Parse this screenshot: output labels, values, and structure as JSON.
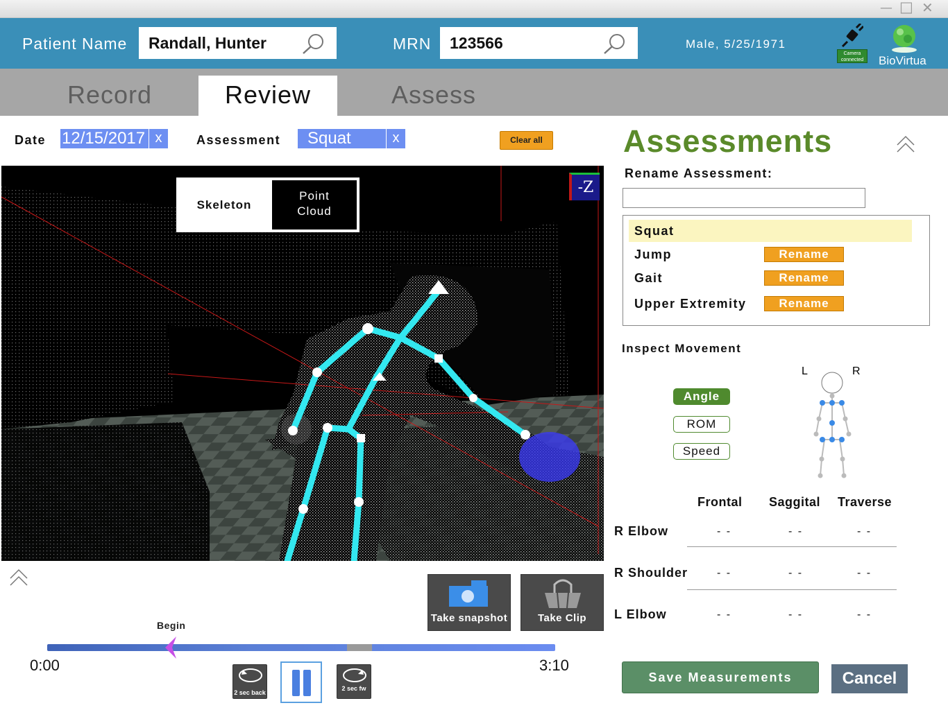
{
  "window": {
    "min_glyph": "—",
    "max_glyph": "□",
    "close_glyph": "✕"
  },
  "header": {
    "patient_name_label": "Patient Name",
    "patient_name_value": "Randall, Hunter",
    "mrn_label": "MRN",
    "mrn_value": "123566",
    "patient_info": "Male, 5/25/1971",
    "camera_status": "Camera connected",
    "logo_text": "BioVirtua"
  },
  "tabs": [
    {
      "label": "Record",
      "active": false
    },
    {
      "label": "Review",
      "active": true
    },
    {
      "label": "Assess",
      "active": false
    }
  ],
  "filters": {
    "date_label": "Date",
    "date_value": "12/15/2017",
    "assessment_label": "Assessment",
    "assessment_value": "Squat",
    "remove_glyph": "x",
    "clear_all": "Clear all"
  },
  "viewport": {
    "view_toggle": {
      "skeleton": "Skeleton",
      "point_cloud": "Point\nCloud",
      "selected": "point_cloud"
    },
    "axis_cube_label": "-Z",
    "skeleton_color": "#33e8f0"
  },
  "actions": {
    "snapshot": "Take snapshot",
    "clip": "Take Clip"
  },
  "playback": {
    "marker_label": "Begin",
    "start_time": "0:00",
    "end_time": "3:10",
    "back_label": "2 sec back",
    "forward_label": "2 sec fw",
    "state": "playing"
  },
  "panel": {
    "title": "Assessments",
    "rename_label": "Rename Assessment:",
    "rename_input_value": "",
    "assessments": [
      {
        "name": "Squat",
        "selected": true,
        "rename": ""
      },
      {
        "name": "Jump",
        "selected": false,
        "rename": "Rename"
      },
      {
        "name": "Gait",
        "selected": false,
        "rename": "Rename"
      },
      {
        "name": "Upper Extremity",
        "selected": false,
        "rename": "Rename"
      }
    ],
    "inspect_label": "Inspect Movement",
    "modes": [
      {
        "label": "Angle",
        "active": true
      },
      {
        "label": "ROM",
        "active": false
      },
      {
        "label": "Speed",
        "active": false
      }
    ],
    "body_left": "L",
    "body_right": "R",
    "columns": [
      "Frontal",
      "Saggital",
      "Traverse"
    ],
    "rows": [
      {
        "joint": "R Elbow",
        "values": [
          "- -",
          "- -",
          "- -"
        ]
      },
      {
        "joint": "R Shoulder",
        "values": [
          "- -",
          "- -",
          "- -"
        ]
      },
      {
        "joint": "L Elbow",
        "values": [
          "- -",
          "- -",
          "- -"
        ]
      }
    ],
    "save": "Save Measurements",
    "cancel": "Cancel"
  },
  "colors": {
    "header": "#3a8fb8",
    "chip": "#6d8ff2",
    "accent_orange": "#f0a020",
    "title_green": "#5a8a2a",
    "save_green": "#5b8f67"
  }
}
